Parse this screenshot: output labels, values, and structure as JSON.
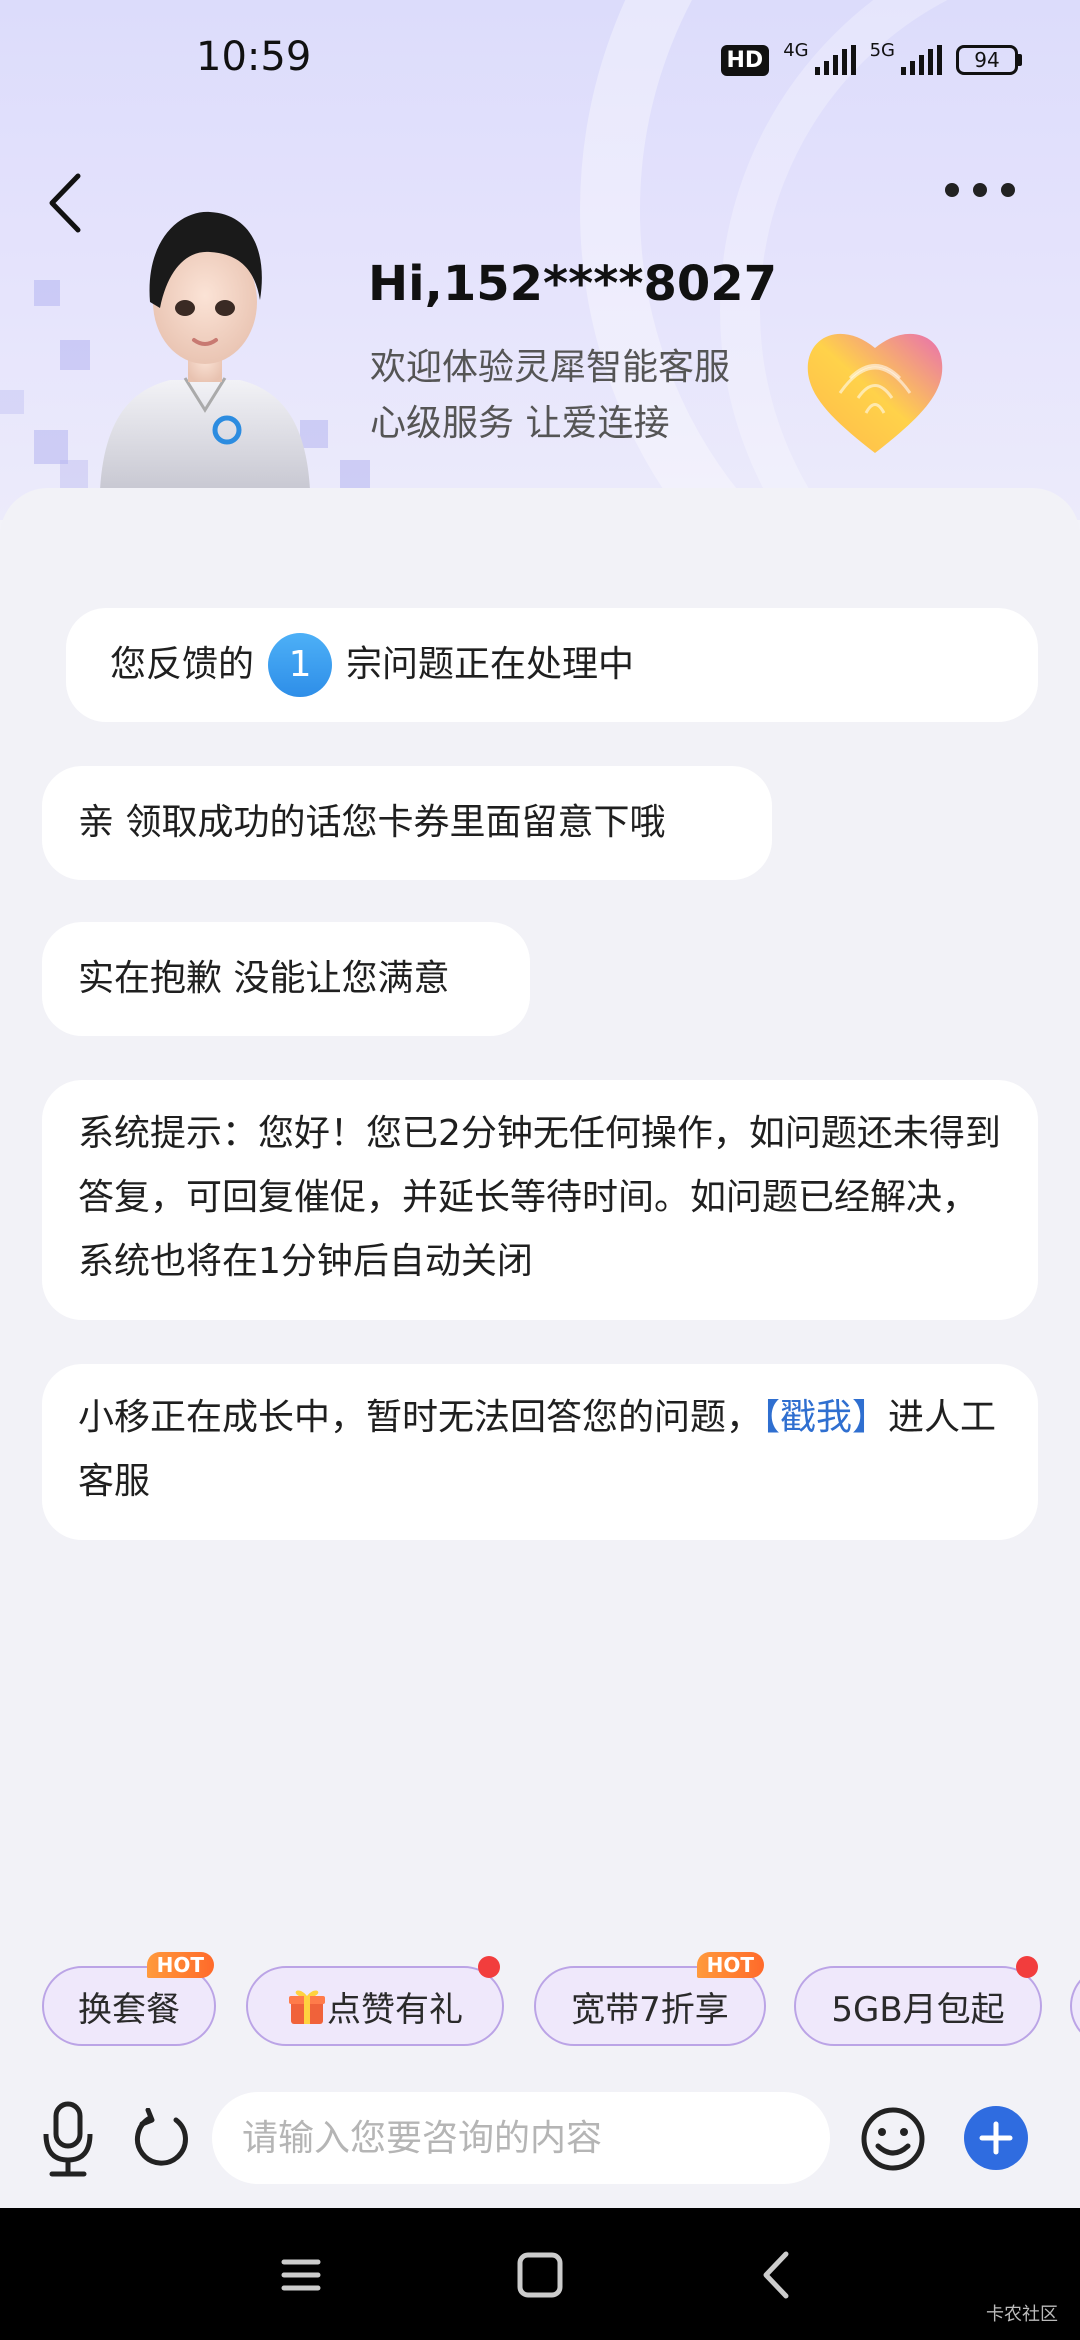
{
  "status_bar": {
    "time": "10:59",
    "hd_badge": "HD",
    "network_1": "4G",
    "network_2": "5G",
    "battery": "94"
  },
  "header": {
    "greeting": "Hi,152****8027",
    "welcome_line1": "欢迎体验灵犀智能客服",
    "welcome_line2": "心级服务 让爱连接"
  },
  "chat": {
    "feedback_prefix": "您反馈的",
    "feedback_count": "1",
    "feedback_suffix": "宗问题正在处理中",
    "messages": [
      "亲 领取成功的话您卡券里面留意下哦",
      "实在抱歉 没能让您满意",
      "系统提示：您好！您已2分钟无任何操作，如问题还未得到答复，可回复催促，并延长等待时间。如问题已经解决，系统也将在1分钟后自动关闭"
    ],
    "bot_text": "小移正在成长中，暂时无法回答您的问题，",
    "bot_link": "【戳我】",
    "bot_text_after": "进人工客服"
  },
  "quick_chips": [
    {
      "label": "换套餐",
      "badge": "HOT"
    },
    {
      "icon": "gift-icon",
      "label": "点赞有礼"
    },
    {
      "label": "宽带7折享",
      "badge": "HOT"
    },
    {
      "label": "5GB月包起"
    }
  ],
  "input": {
    "placeholder": "请输入您要咨询的内容"
  },
  "watermark": "卡农社区",
  "colors": {
    "accent_blue": "#2f6ce0",
    "chip_bg": "#efe8fb",
    "hot_badge": "#ff7a30",
    "link": "#2f6fd0"
  }
}
